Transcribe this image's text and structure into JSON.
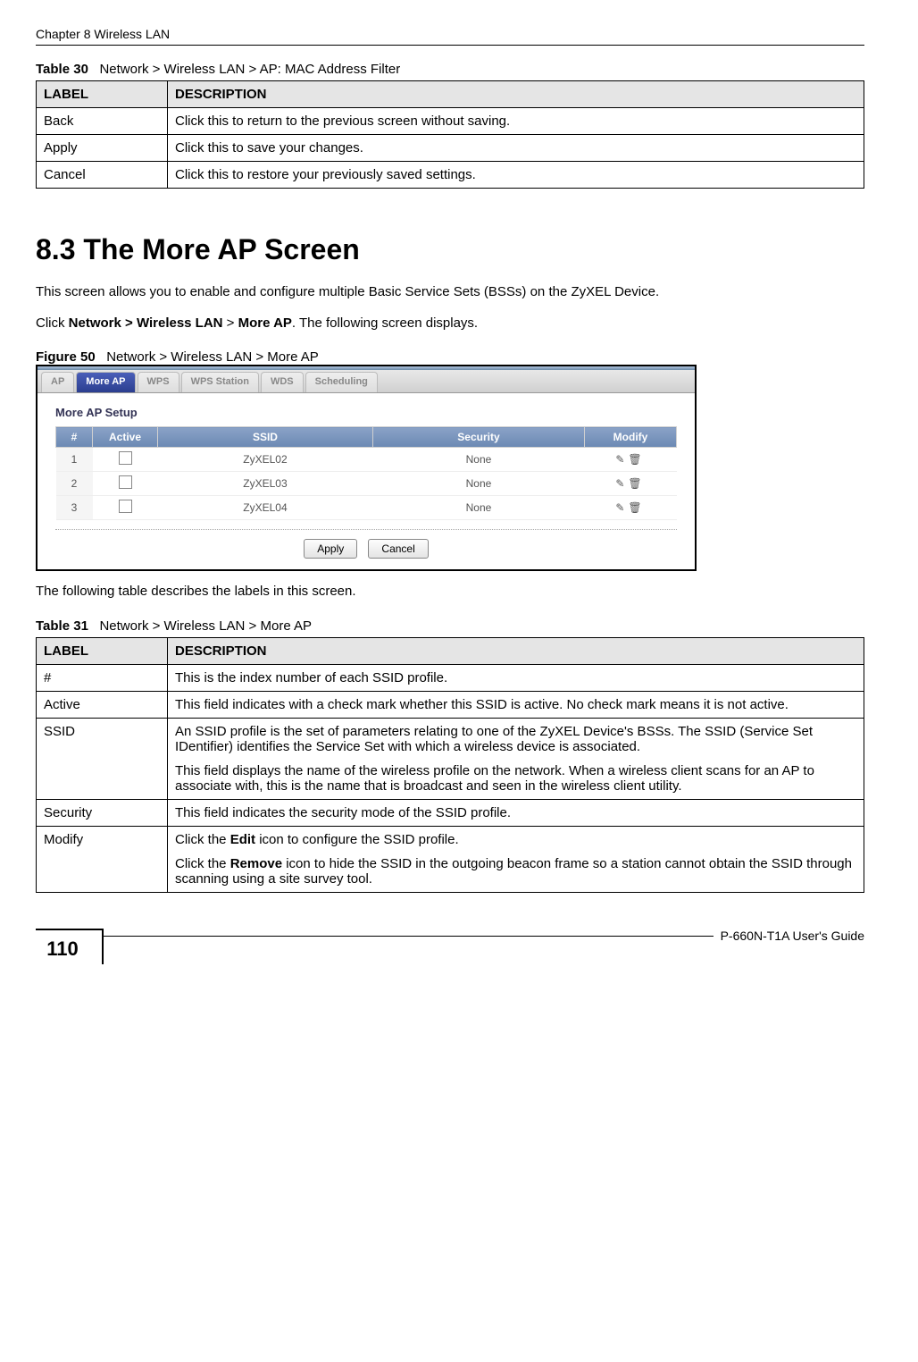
{
  "header": {
    "chapter": "Chapter 8 Wireless LAN"
  },
  "table30": {
    "caption_num": "Table 30",
    "caption_text": "Network > Wireless LAN > AP: MAC Address Filter",
    "headers": {
      "label": "LABEL",
      "desc": "DESCRIPTION"
    },
    "rows": [
      {
        "label": "Back",
        "desc": "Click this to return to the previous screen without saving."
      },
      {
        "label": "Apply",
        "desc": "Click this to save your changes."
      },
      {
        "label": "Cancel",
        "desc": "Click this to restore your previously saved settings."
      }
    ]
  },
  "section": {
    "title": "8.3  The More AP Screen",
    "para1": "This screen allows you to enable and configure multiple Basic Service Sets (BSSs) on the ZyXEL Device.",
    "para2_pre": "Click ",
    "para2_bold1": "Network > Wireless LAN",
    "para2_mid": " > ",
    "para2_bold2": "More AP",
    "para2_post": ". The following screen displays."
  },
  "figure": {
    "caption_num": "Figure 50",
    "caption_text": "Network > Wireless LAN > More AP",
    "tabs": [
      "AP",
      "More AP",
      "WPS",
      "WPS Station",
      "WDS",
      "Scheduling"
    ],
    "panel_title": "More AP Setup",
    "columns": {
      "num": "#",
      "active": "Active",
      "ssid": "SSID",
      "security": "Security",
      "modify": "Modify"
    },
    "rows": [
      {
        "n": "1",
        "ssid": "ZyXEL02",
        "sec": "None"
      },
      {
        "n": "2",
        "ssid": "ZyXEL03",
        "sec": "None"
      },
      {
        "n": "3",
        "ssid": "ZyXEL04",
        "sec": "None"
      }
    ],
    "buttons": {
      "apply": "Apply",
      "cancel": "Cancel"
    }
  },
  "after_figure": "The following table describes the labels in this screen.",
  "table31": {
    "caption_num": "Table 31",
    "caption_text": "Network > Wireless LAN > More AP",
    "headers": {
      "label": "LABEL",
      "desc": "DESCRIPTION"
    },
    "rows": {
      "r0": {
        "label": "#",
        "desc": "This is the index number of each SSID profile."
      },
      "r1": {
        "label": "Active",
        "desc": "This field indicates with a check mark whether this SSID is active. No check mark means it is not active."
      },
      "r2": {
        "label": "SSID",
        "p1": "An SSID profile is the set of parameters relating to one of the ZyXEL Device's BSSs. The SSID (Service Set IDentifier) identifies the Service Set with which a wireless device is associated.",
        "p2": "This field displays the name of the wireless profile on the network. When a wireless client scans for an AP to associate with, this is the name that is broadcast and seen in the wireless client utility."
      },
      "r3": {
        "label": "Security",
        "desc": "This field indicates the security mode of the SSID profile."
      },
      "r4": {
        "label": "Modify",
        "p1_pre": "Click the ",
        "p1_bold": "Edit",
        "p1_post": " icon to configure the SSID profile.",
        "p2_pre": "Click the ",
        "p2_bold": "Remove",
        "p2_post": " icon to hide the SSID in the outgoing beacon frame so a station cannot obtain the SSID through scanning using a site survey tool."
      }
    }
  },
  "footer": {
    "page": "110",
    "guide": "P-660N-T1A User's Guide"
  }
}
